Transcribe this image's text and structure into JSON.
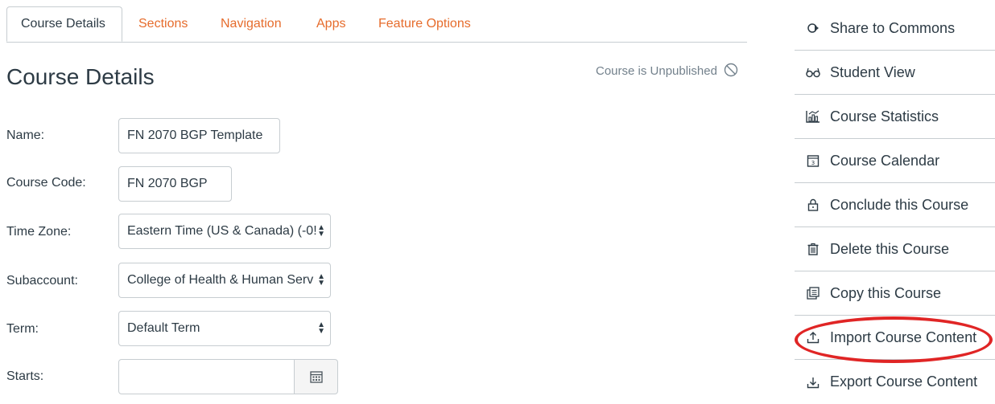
{
  "tabs": [
    {
      "label": "Course Details",
      "active": true
    },
    {
      "label": "Sections"
    },
    {
      "label": "Navigation"
    },
    {
      "label": "Apps"
    },
    {
      "label": "Feature Options"
    }
  ],
  "page_title": "Course Details",
  "publish_status": "Course is Unpublished",
  "form": {
    "name_label": "Name:",
    "name_value": "FN 2070 BGP Template",
    "code_label": "Course Code:",
    "code_value": "FN 2070 BGP",
    "timezone_label": "Time Zone:",
    "timezone_value": "Eastern Time (US & Canada) (-0!",
    "subaccount_label": "Subaccount:",
    "subaccount_value": "College of Health & Human Serv",
    "term_label": "Term:",
    "term_value": "Default Term",
    "starts_label": "Starts:",
    "starts_value": ""
  },
  "sidebar": {
    "items": [
      {
        "label": "Share to Commons",
        "icon": "share-icon"
      },
      {
        "label": "Student View",
        "icon": "glasses-icon"
      },
      {
        "label": "Course Statistics",
        "icon": "statistics-icon"
      },
      {
        "label": "Course Calendar",
        "icon": "calendar-icon"
      },
      {
        "label": "Conclude this Course",
        "icon": "lock-icon"
      },
      {
        "label": "Delete this Course",
        "icon": "trash-icon"
      },
      {
        "label": "Copy this Course",
        "icon": "copy-icon"
      },
      {
        "label": "Import Course Content",
        "icon": "upload-icon"
      },
      {
        "label": "Export Course Content",
        "icon": "download-icon"
      }
    ]
  },
  "colors": {
    "tab_link": "#e66c2c",
    "text": "#2d3b45",
    "muted": "#73818c",
    "border": "#c7cdd1",
    "highlight": "#e02525"
  }
}
